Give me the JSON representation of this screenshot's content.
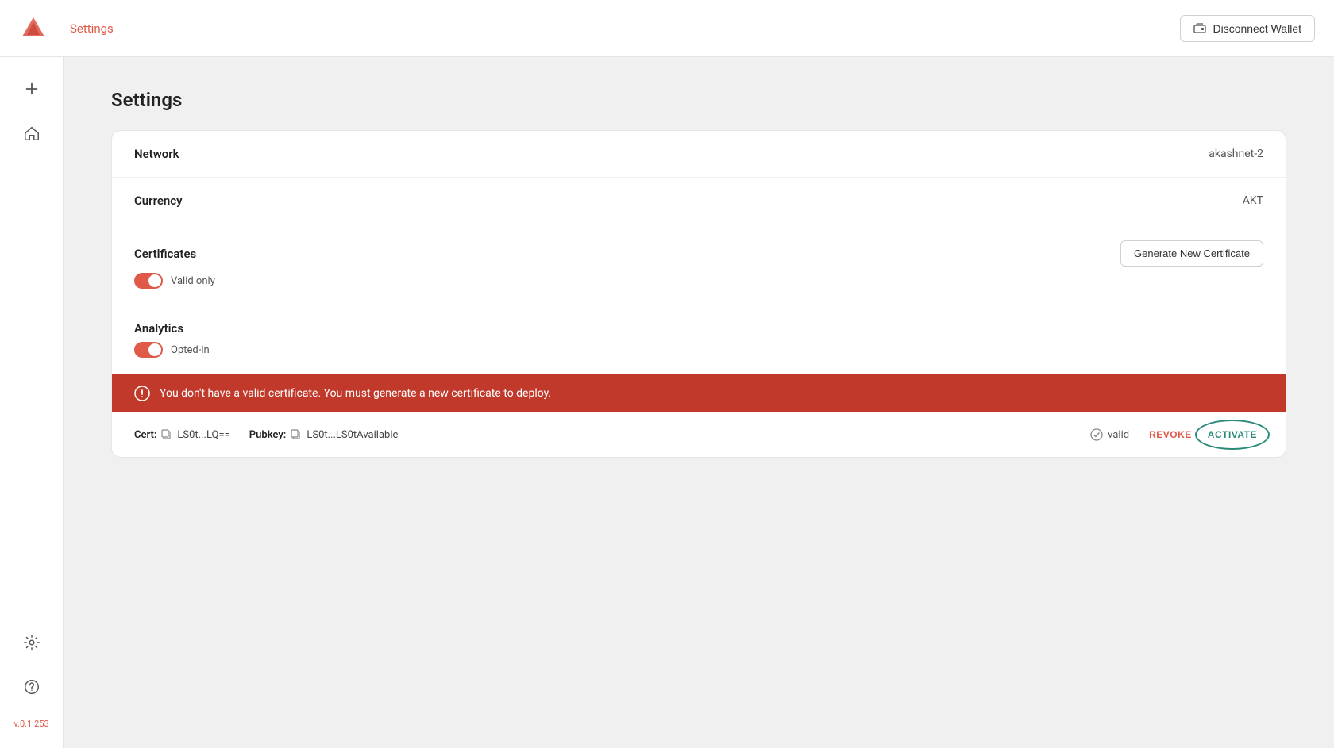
{
  "header": {
    "title": "Settings",
    "disconnect_button_label": "Disconnect Wallet"
  },
  "sidebar": {
    "items": [
      {
        "name": "add",
        "icon": "plus"
      },
      {
        "name": "home",
        "icon": "home"
      }
    ],
    "bottom_items": [
      {
        "name": "settings",
        "icon": "gear"
      },
      {
        "name": "help",
        "icon": "question"
      }
    ],
    "version": "v.0.1.253"
  },
  "page": {
    "title": "Settings"
  },
  "settings": {
    "network_label": "Network",
    "network_value": "akashnet-2",
    "currency_label": "Currency",
    "currency_value": "AKT",
    "certificates_label": "Certificates",
    "certificates_toggle_label": "Valid only",
    "certificates_toggle_on": true,
    "generate_cert_btn": "Generate New Certificate",
    "analytics_label": "Analytics",
    "analytics_toggle_label": "Opted-in",
    "analytics_toggle_on": true,
    "alert_message": "You don't have a valid certificate. You must generate a new certificate to deploy.",
    "cert_label": "Cert:",
    "cert_value": "LS0t...LQ==",
    "pubkey_label": "Pubkey:",
    "pubkey_value": "LS0t...LS0tAvailable",
    "valid_label": "valid",
    "revoke_label": "REVOKE",
    "activate_label": "ACTIVATE"
  }
}
